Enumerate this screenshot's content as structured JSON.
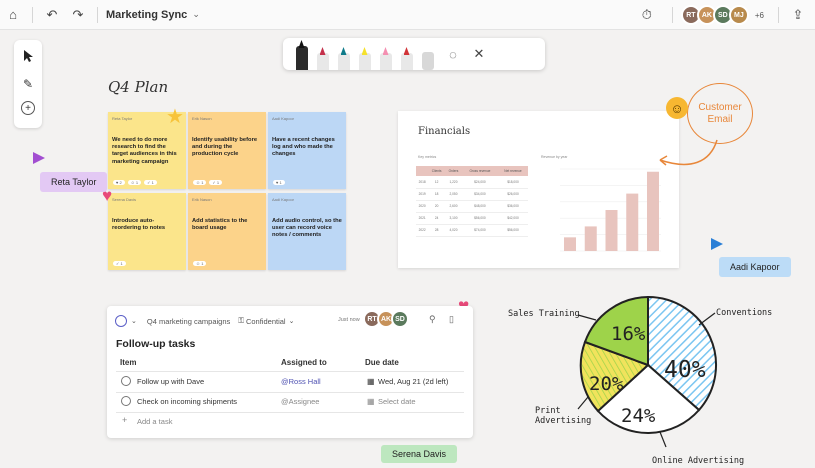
{
  "topbar": {
    "doc_title": "Marketing Sync",
    "extra_count": "+6",
    "avatars": [
      {
        "initials": "RT",
        "color": "#8a6a5c"
      },
      {
        "initials": "AK",
        "color": "#c7925a"
      },
      {
        "initials": "SD",
        "color": "#5b7a5d"
      },
      {
        "initials": "MJ",
        "color": "#b88a4c"
      }
    ]
  },
  "canvas": {
    "title": "Q4 Plan"
  },
  "notes": [
    {
      "header": "Reta Taylor",
      "text": "We need to do more research to find the target audiences in this marketing campaign",
      "color": "#fbe58b",
      "foot": [
        "♥ 2",
        "☺ 1",
        "✓ 1"
      ]
    },
    {
      "header": "Erik Nason",
      "text": "Identify usability before and during the production cycle",
      "color": "#fcd38a",
      "foot": [
        "☺ 1",
        "✓ 1"
      ]
    },
    {
      "header": "Aadi Kapoor",
      "text": "Have a recent changes log and who made the changes",
      "color": "#bcd7f5",
      "foot": [
        "♥ 1"
      ]
    },
    {
      "header": "Serena Davis",
      "text": "Introduce auto-reordering to notes",
      "color": "#fbe58b",
      "foot": [
        "✓ 1"
      ]
    },
    {
      "header": "Erik Nason",
      "text": "Add statistics to the board usage",
      "color": "#fcd38a",
      "foot": [
        "☺ 1"
      ]
    },
    {
      "header": "Aadi Kapoor",
      "text": "Add audio control, so the user can record voice notes / comments",
      "color": "#bcd7f5",
      "foot": []
    }
  ],
  "cursors": {
    "reta": "Reta Taylor",
    "aadi": "Aadi Kapoor",
    "serena": "Serena Davis"
  },
  "financials": {
    "title": "Financials",
    "table_label": "Key metrics",
    "chart_label": "Revenue by year",
    "columns": [
      "",
      "Clients",
      "Orders",
      "Gross revenue",
      "Net revenue"
    ],
    "rows": [
      [
        "2018",
        "12",
        "1,220",
        "$24,000",
        "$18,000"
      ],
      [
        "2019",
        "18",
        "2,050",
        "$34,000",
        "$26,000"
      ],
      [
        "2020",
        "20",
        "2,600",
        "$48,000",
        "$36,000"
      ],
      [
        "2021",
        "24",
        "3,100",
        "$56,000",
        "$42,000"
      ],
      [
        "2022",
        "28",
        "4,020",
        "$74,000",
        "$56,000"
      ]
    ],
    "bars": [
      10,
      18,
      30,
      42,
      58
    ],
    "bar_color": "#e8c4be"
  },
  "customer_email": {
    "line1": "Customer",
    "line2": "Email"
  },
  "followup": {
    "breadcrumb": "Q4 marketing campaigns",
    "sensitivity": "Confidential",
    "edited": "Just now",
    "title": "Follow-up tasks",
    "columns": {
      "item": "Item",
      "assigned": "Assigned to",
      "due": "Due date"
    },
    "rows": [
      {
        "item": "Follow up with Dave",
        "assigned": "@Ross Hall",
        "due": "Wed, Aug 21 (2d left)"
      },
      {
        "item": "Check on incoming shipments",
        "assigned": "@Assignee",
        "due": "Select date"
      }
    ],
    "add_task": "Add a task"
  },
  "pie": {
    "labels": {
      "sales": "Sales Training",
      "conventions": "Conventions",
      "print": "Print Advertising",
      "online": "Online Advertising"
    },
    "values": {
      "sales": "16%",
      "conventions": "40%",
      "print": "20%",
      "online": "24%"
    },
    "colors": {
      "green": "#9ed34a",
      "yellow": "#f1e35c",
      "blue": "#7cc6f1"
    }
  }
}
